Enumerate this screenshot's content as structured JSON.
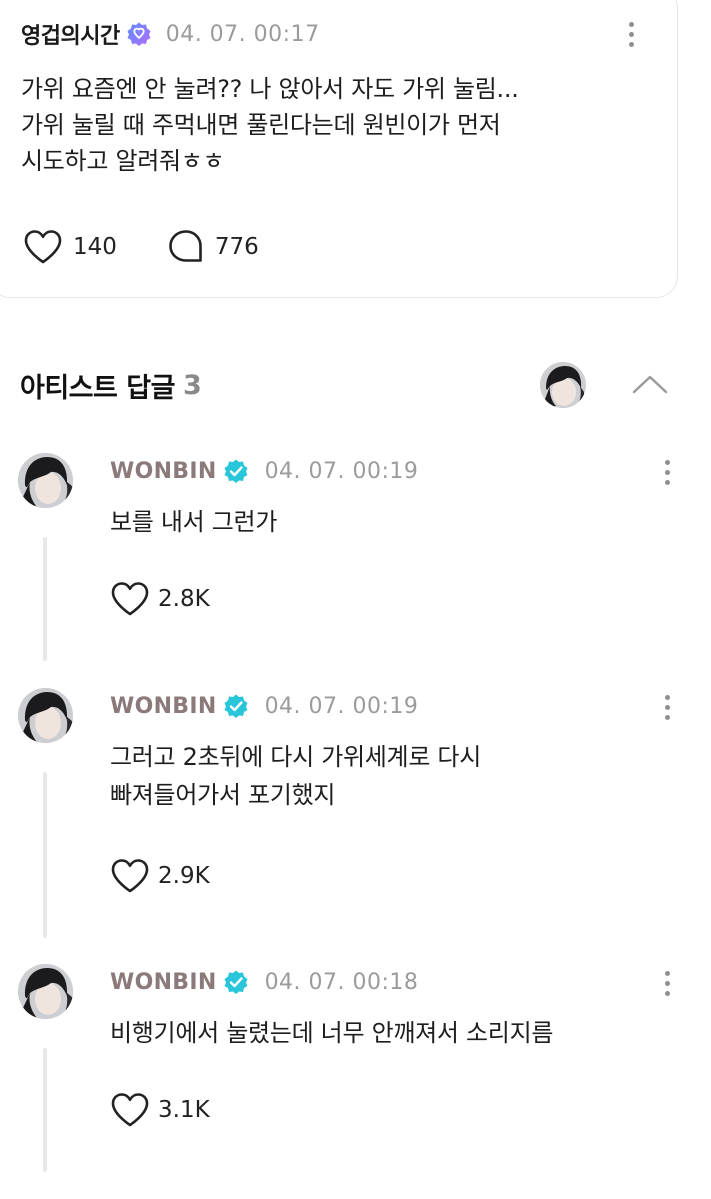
{
  "post": {
    "author": "영겁의시간",
    "timestamp": "04. 07. 00:17",
    "body_lines": [
      "가위 요즘엔 안 눌려?? 나 앉아서 자도 가위 눌림...",
      "가위 눌릴 때 주먹내면 풀린다는데 원빈이가 먼저",
      "시도하고 알려줘ㅎㅎ"
    ],
    "likes": "140",
    "comments": "776",
    "icons": {
      "verified": "verified-badge-icon",
      "more": "more-vertical-icon",
      "like": "heart-icon",
      "comment": "comment-bubble-icon"
    }
  },
  "artist_replies": {
    "title": "아티스트 답글",
    "count": "3",
    "collapse_icon": "chevron-up-icon",
    "replies": [
      {
        "author": "WONBIN",
        "timestamp": "04. 07. 00:19",
        "text_lines": [
          "보를 내서 그런가"
        ],
        "likes": "2.8K"
      },
      {
        "author": "WONBIN",
        "timestamp": "04. 07. 00:19",
        "text_lines": [
          "그러고 2초뒤에 다시 가위세계로 다시",
          "빠져들어가서 포기했지"
        ],
        "likes": "2.9K"
      },
      {
        "author": "WONBIN",
        "timestamp": "04. 07. 00:18",
        "text_lines": [
          "비행기에서 눌렸는데 너무 안깨져서 소리지름"
        ],
        "likes": "3.1K"
      }
    ]
  },
  "colors": {
    "artist_name": "#8c7a7a",
    "verified_artist": "#29c5d9",
    "verified_fan_start": "#5b8dff",
    "verified_fan_end": "#b46dff",
    "timestamp": "#9b9b9b",
    "divider": "#e6e6e6"
  }
}
